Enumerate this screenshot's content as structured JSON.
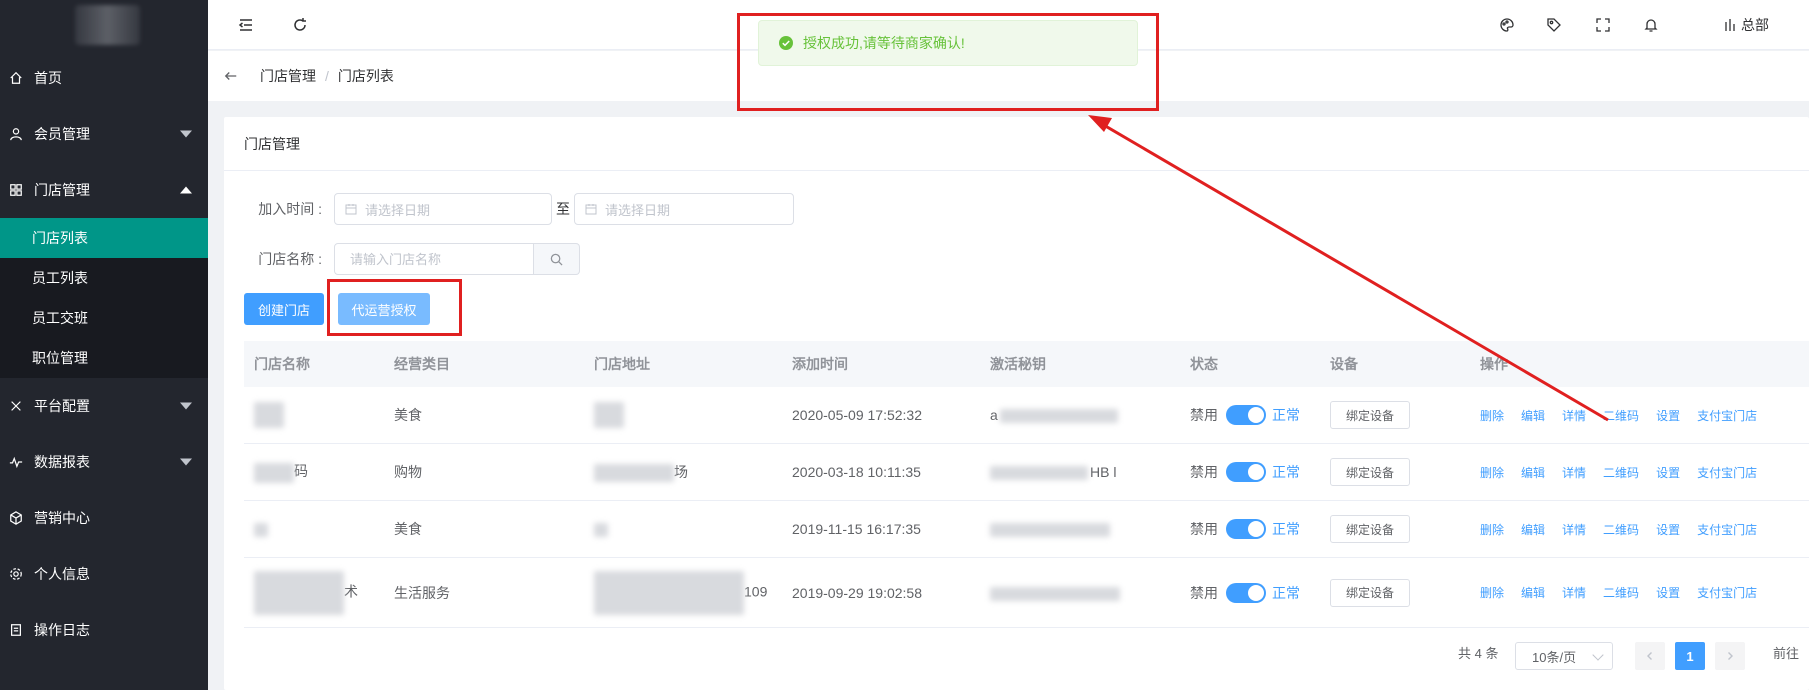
{
  "sidebar": {
    "items": [
      {
        "label": "首页",
        "icon": "home-icon"
      },
      {
        "label": "会员管理",
        "icon": "user-icon"
      },
      {
        "label": "门店管理",
        "icon": "grid-icon"
      },
      {
        "label": "平台配置",
        "icon": "tools-icon"
      },
      {
        "label": "数据报表",
        "icon": "pulse-icon"
      },
      {
        "label": "营销中心",
        "icon": "box-icon"
      },
      {
        "label": "个人信息",
        "icon": "gear-icon"
      },
      {
        "label": "操作日志",
        "icon": "log-icon"
      }
    ],
    "submenu": [
      "门店列表",
      "员工列表",
      "员工交班",
      "职位管理"
    ]
  },
  "header": {
    "user": "总部"
  },
  "breadcrumb": [
    "门店管理",
    "门店列表"
  ],
  "toast": "授权成功,请等待商家确认!",
  "card_title": "门店管理",
  "filters": {
    "join_time_label": "加入时间 :",
    "date_placeholder": "请选择日期",
    "to": "至",
    "store_name_label": "门店名称 :",
    "store_name_placeholder": "请输入门店名称"
  },
  "buttons": {
    "create": "创建门店",
    "authorize": "代运营授权"
  },
  "table": {
    "headers": [
      "门店名称",
      "经营类目",
      "门店地址",
      "添加时间",
      "激活秘钥",
      "状态",
      "设备",
      "操作"
    ],
    "rows": [
      {
        "name": "",
        "category": "美食",
        "address": "",
        "time": "2020-05-09 17:52:32",
        "key": "a"
      },
      {
        "name": "码",
        "category": "购物",
        "address": "场",
        "time": "2020-03-18 10:11:35",
        "key": "HB l"
      },
      {
        "name": "",
        "category": "美食",
        "address": "",
        "time": "2019-11-15 16:17:35",
        "key": ""
      },
      {
        "name": "术",
        "category": "生活服务",
        "address": "109",
        "time": "2019-09-29 19:02:58",
        "key": ""
      }
    ],
    "status_off": "禁用",
    "status_on": "正常",
    "bind_label": "绑定设备",
    "ops": [
      "删除",
      "编辑",
      "详情",
      "二维码",
      "设置",
      "支付宝门店"
    ]
  },
  "pagination": {
    "total": "共 4 条",
    "page_size": "10条/页",
    "current": "1",
    "goto": "前往"
  }
}
